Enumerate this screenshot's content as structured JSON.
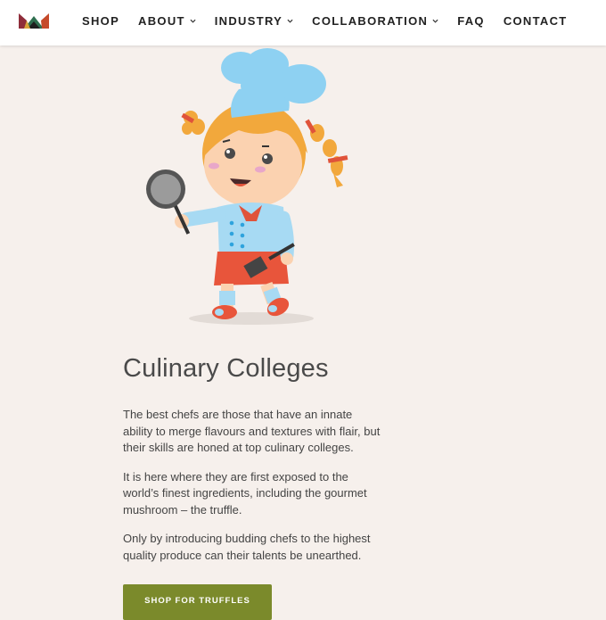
{
  "nav": {
    "items": [
      {
        "label": "SHOP",
        "has_dropdown": false
      },
      {
        "label": "ABOUT",
        "has_dropdown": true
      },
      {
        "label": "INDUSTRY",
        "has_dropdown": true
      },
      {
        "label": "COLLABORATION",
        "has_dropdown": true
      },
      {
        "label": "FAQ",
        "has_dropdown": false
      },
      {
        "label": "CONTACT",
        "has_dropdown": false
      }
    ]
  },
  "main": {
    "title": "Culinary Colleges",
    "paragraphs": [
      "The best chefs are those that have an innate ability to merge flavours and textures with flair, but their skills are honed at top culinary colleges.",
      "It is here where they are first exposed to the world’s finest ingredients, including the gourmet mushroom – the truffle.",
      "Only by introducing budding chefs to the highest quality produce can their talents be unearthed."
    ],
    "cta_label": "SHOP FOR TRUFFLES"
  },
  "icons": {
    "logo": "crown-logo-icon",
    "dropdown": "chevron-down-icon",
    "illustration": "girl-chef-illustration"
  },
  "colors": {
    "background": "#f6f0ec",
    "header": "#ffffff",
    "button": "#7b8a2b",
    "text": "#444444"
  }
}
